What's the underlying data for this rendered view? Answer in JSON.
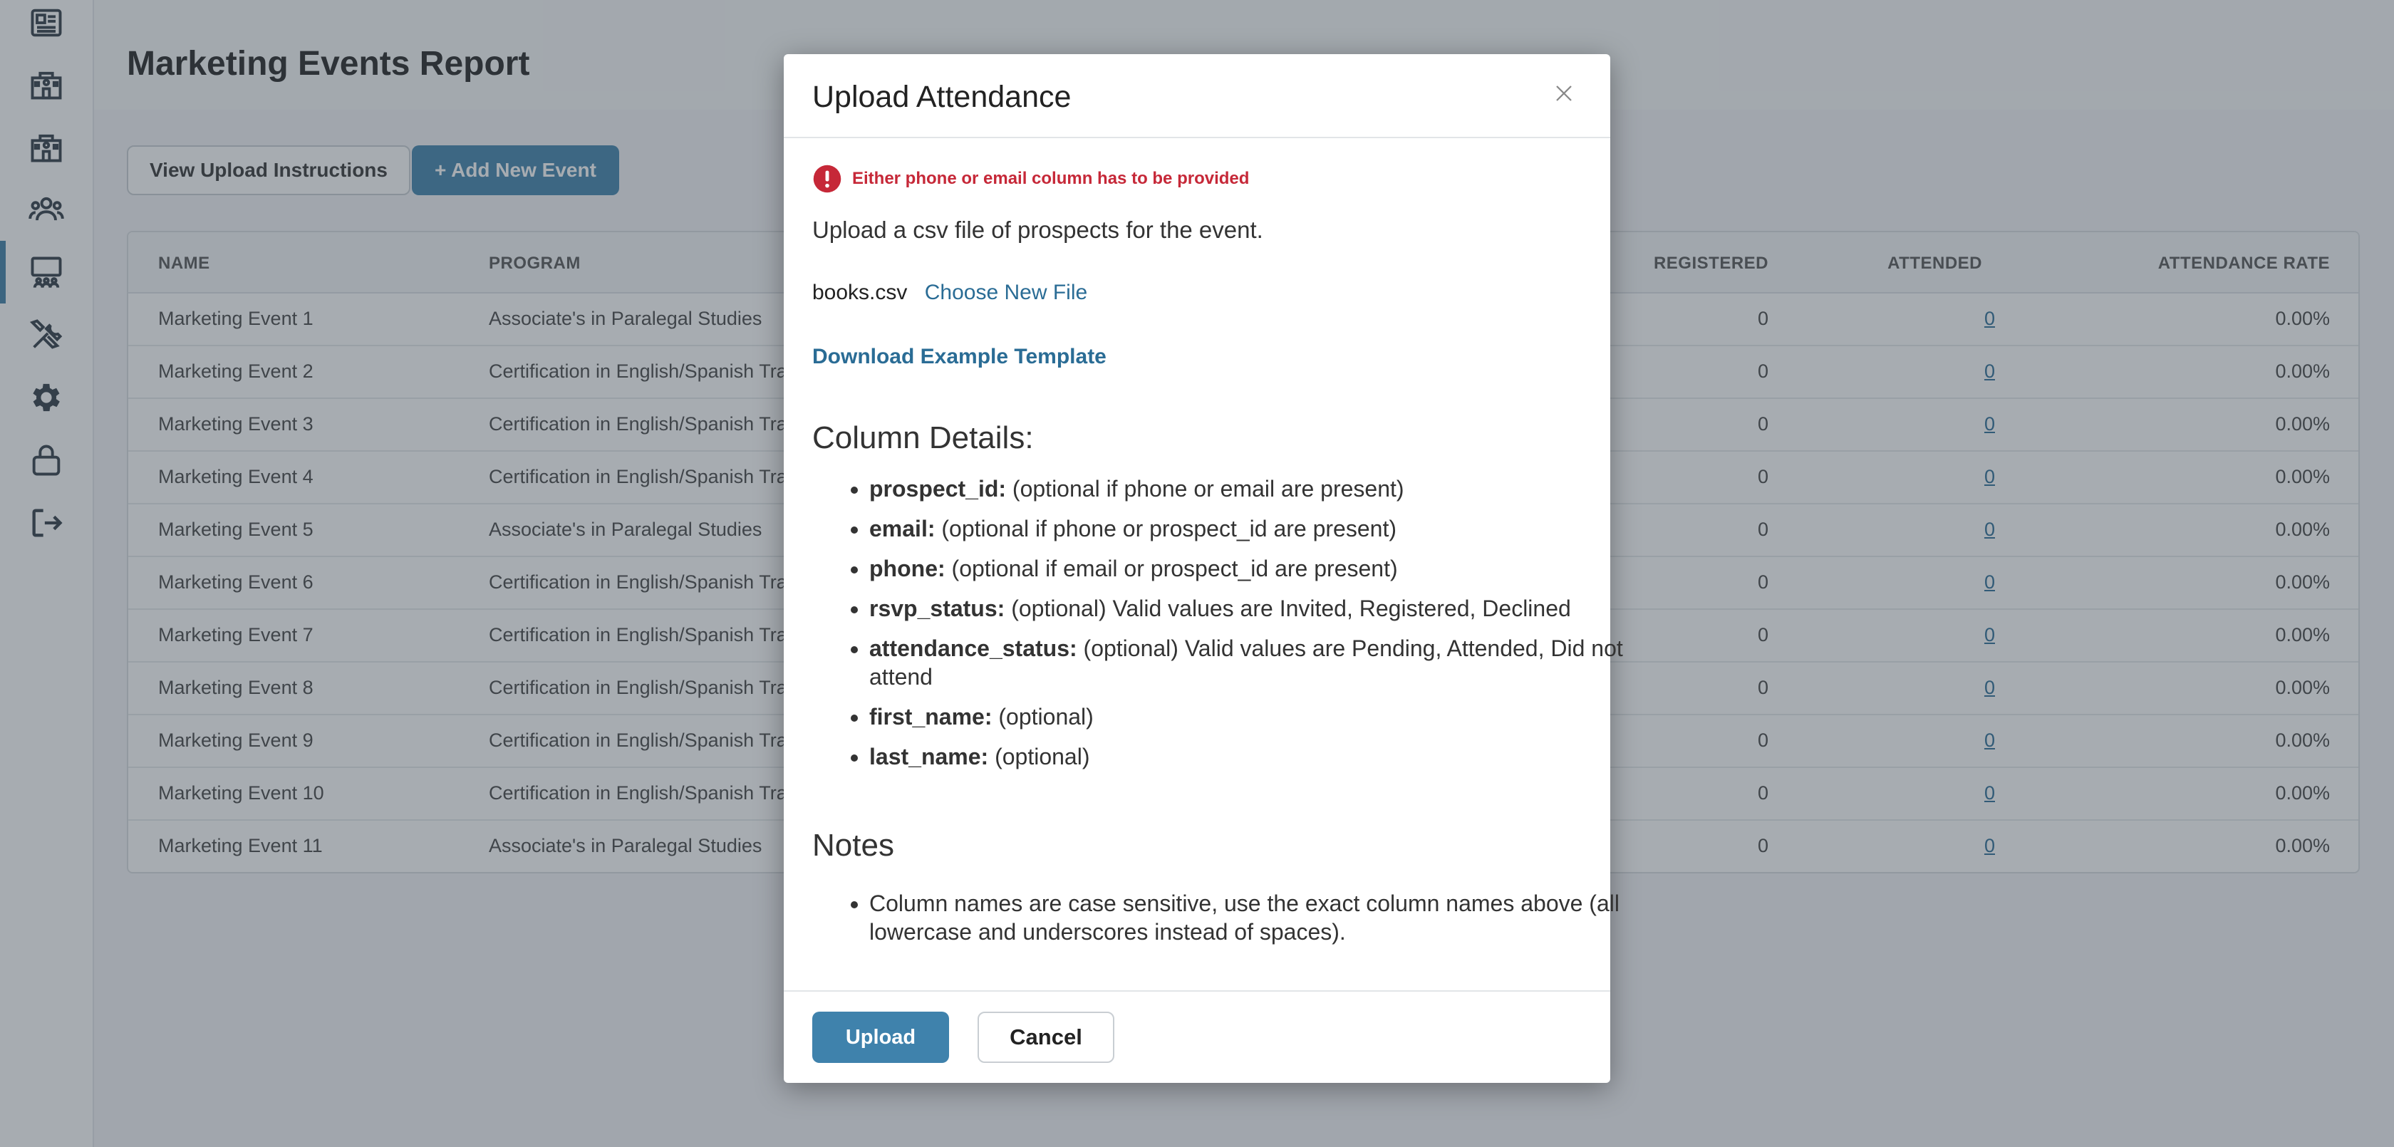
{
  "page": {
    "title": "Marketing Events Report",
    "view_instructions_label": "View Upload Instructions",
    "add_event_label": "+ Add New Event"
  },
  "sidebar": {
    "items": [
      {
        "icon": "newspaper-icon"
      },
      {
        "icon": "school-building-icon"
      },
      {
        "icon": "school-building-icon"
      },
      {
        "icon": "users-icon"
      },
      {
        "icon": "presentation-icon",
        "active": true
      },
      {
        "icon": "tools-icon"
      },
      {
        "icon": "gear-icon"
      },
      {
        "icon": "lock-icon"
      },
      {
        "icon": "logout-icon"
      }
    ]
  },
  "table": {
    "headers": {
      "name": "NAME",
      "program": "PROGRAM",
      "registered": "REGISTERED",
      "attended": "ATTENDED",
      "rate": "ATTENDANCE RATE"
    },
    "rows": [
      {
        "name": "Marketing Event 1",
        "program": "Associate's in Paralegal Studies",
        "registered": "0",
        "attended": "0",
        "rate": "0.00%"
      },
      {
        "name": "Marketing Event 2",
        "program": "Certification in English/Spanish Trans",
        "registered": "0",
        "attended": "0",
        "rate": "0.00%"
      },
      {
        "name": "Marketing Event 3",
        "program": "Certification in English/Spanish Trans",
        "registered": "0",
        "attended": "0",
        "rate": "0.00%"
      },
      {
        "name": "Marketing Event 4",
        "program": "Certification in English/Spanish Trans",
        "registered": "0",
        "attended": "0",
        "rate": "0.00%"
      },
      {
        "name": "Marketing Event 5",
        "program": "Associate's in Paralegal Studies",
        "registered": "0",
        "attended": "0",
        "rate": "0.00%"
      },
      {
        "name": "Marketing Event 6",
        "program": "Certification in English/Spanish Trans",
        "registered": "0",
        "attended": "0",
        "rate": "0.00%"
      },
      {
        "name": "Marketing Event 7",
        "program": "Certification in English/Spanish Trans",
        "registered": "0",
        "attended": "0",
        "rate": "0.00%"
      },
      {
        "name": "Marketing Event 8",
        "program": "Certification in English/Spanish Trans",
        "registered": "0",
        "attended": "0",
        "rate": "0.00%"
      },
      {
        "name": "Marketing Event 9",
        "program": "Certification in English/Spanish Trans",
        "registered": "0",
        "attended": "0",
        "rate": "0.00%"
      },
      {
        "name": "Marketing Event 10",
        "program": "Certification in English/Spanish Trans",
        "registered": "0",
        "attended": "0",
        "rate": "0.00%"
      },
      {
        "name": "Marketing Event 11",
        "program": "Associate's in Paralegal Studies",
        "registered": "0",
        "attended": "0",
        "rate": "0.00%"
      }
    ]
  },
  "modal": {
    "title": "Upload Attendance",
    "error": "Either phone or email column has to be provided",
    "intro": "Upload a csv file of prospects for the event.",
    "file_name": "books.csv",
    "choose_file_label": "Choose New File",
    "download_template_label": "Download Example Template",
    "column_details_heading": "Column Details:",
    "columns": [
      {
        "name": "prospect_id:",
        "desc": " (optional if phone or email are present)"
      },
      {
        "name": "email:",
        "desc": " (optional if phone or prospect_id are present)"
      },
      {
        "name": "phone:",
        "desc": " (optional if email or prospect_id are present)"
      },
      {
        "name": "rsvp_status:",
        "desc": " (optional) Valid values are Invited, Registered, Declined"
      },
      {
        "name": "attendance_status:",
        "desc": " (optional) Valid values are Pending, Attended, Did not attend"
      },
      {
        "name": "first_name:",
        "desc": " (optional)"
      },
      {
        "name": "last_name:",
        "desc": " (optional)"
      }
    ],
    "notes_heading": "Notes",
    "notes": [
      "Column names are case sensitive, use the exact column names above (all lowercase and underscores instead of spaces)."
    ],
    "upload_label": "Upload",
    "cancel_label": "Cancel"
  },
  "colors": {
    "accent": "#3f82ac",
    "link": "#2a6c95",
    "error": "#c62838"
  }
}
